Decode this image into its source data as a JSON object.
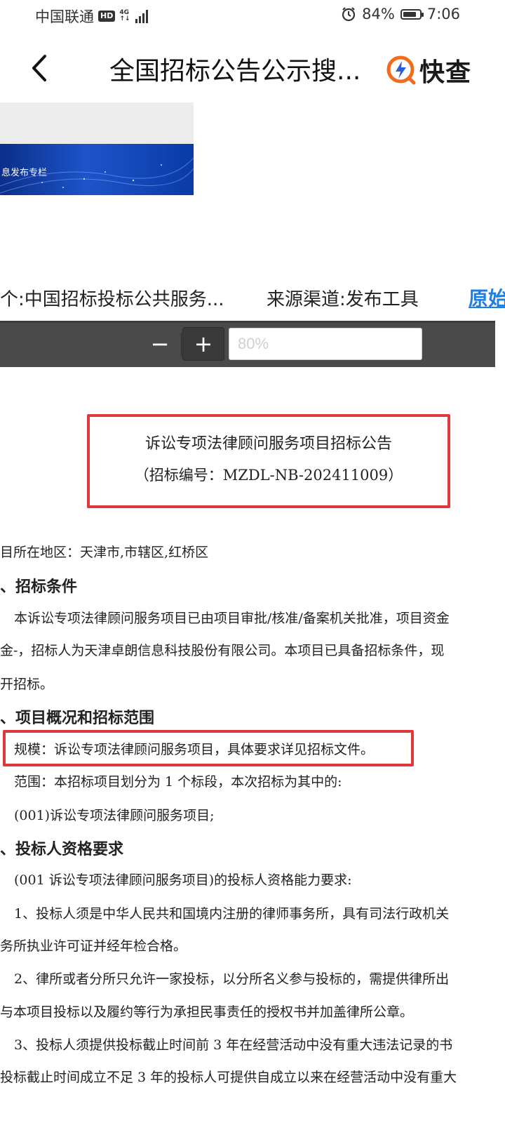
{
  "status": {
    "carrier": "中国联通",
    "hd": "HD",
    "network_top": "4G",
    "network_bottom": "↑↓",
    "battery_percent": "84%",
    "battery_level": 0.84,
    "time": "7:06",
    "icons": [
      "alarm-icon",
      "signal-icon",
      "battery-icon"
    ]
  },
  "header": {
    "title": "全国招标公告公示搜...",
    "brand": "快查",
    "back_icon": "chevron-left-icon",
    "brand_icon": "lightning-q-icon",
    "brand_color": "#f26b1d",
    "brand_accent": "#2b5fd9"
  },
  "banner": {
    "text": "息发布专栏"
  },
  "source": {
    "publisher": "个:中国招标投标公共服务...",
    "channel": "来源渠道:发布工具",
    "link": "原始"
  },
  "toolbar": {
    "minus": "−",
    "plus": "+",
    "zoom_placeholder": "80%"
  },
  "document": {
    "title": "诉讼专项法律顾问服务项目招标公告",
    "number": "（招标编号：MZDL-NB-202411009）",
    "region": "目所在地区：天津市,市辖区,红桥区",
    "section1": "、招标条件",
    "s1_line1": "本诉讼专项法律顾问服务项目已由项目审批/核准/备案机关批准，项目资金",
    "s1_line2": "金-，招标人为天津卓朗信息科技股份有限公司。本项目已具备招标条件，现",
    "s1_line3": "开招标。",
    "section2": "、项目概况和招标范围",
    "scale": "规模：诉讼专项法律顾问服务项目，具体要求详见招标文件。",
    "range": "范围：本招标项目划分为 1 个标段，本次招标为其中的:",
    "lot": "(001)诉讼专项法律顾问服务项目;",
    "section3": "、投标人资格要求",
    "q_intro": "(001 诉讼专项法律顾问服务项目)的投标人资格能力要求:",
    "q1_line1": "1、投标人须是中华人民共和国境内注册的律师事务所，具有司法行政机关",
    "q1_line2": "务所执业许可证并经年检合格。",
    "q2_line1": "2、律所或者分所只允许一家投标，以分所名义参与投标的，需提供律所出",
    "q2_line2": "与本项目投标以及履约等行为承担民事责任的授权书并加盖律所公章。",
    "q3_line1": "3、投标人须提供投标截止时间前 3 年在经营活动中没有重大违法记录的书",
    "q3_line2": "投标截止时间成立不足 3 年的投标人可提供自成立以来在经营活动中没有重大"
  },
  "highlight_color": "#e0393b"
}
